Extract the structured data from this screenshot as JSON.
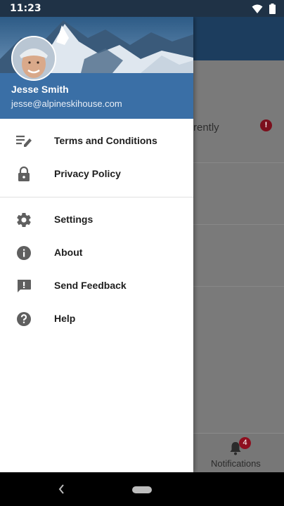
{
  "status_bar": {
    "time": "11:23"
  },
  "drawer": {
    "user": {
      "name": "Jesse Smith",
      "email": "jesse@alpineskihouse.com"
    },
    "primary_items": [
      {
        "label": "Terms and Conditions",
        "icon": "edit-list-icon"
      },
      {
        "label": "Privacy Policy",
        "icon": "lock-icon"
      }
    ],
    "secondary_items": [
      {
        "label": "Settings",
        "icon": "gear-icon"
      },
      {
        "label": "About",
        "icon": "info-icon"
      },
      {
        "label": "Send Feedback",
        "icon": "feedback-icon"
      },
      {
        "label": "Help",
        "icon": "help-icon"
      }
    ]
  },
  "background_app": {
    "partial_text": "rrently",
    "alert_glyph": "!",
    "notifications_label": "Notifications",
    "notifications_badge": "4"
  },
  "colors": {
    "header_band": "#3a6fa6",
    "status_bar": "#1f3246",
    "badge": "#8e0f1f"
  }
}
